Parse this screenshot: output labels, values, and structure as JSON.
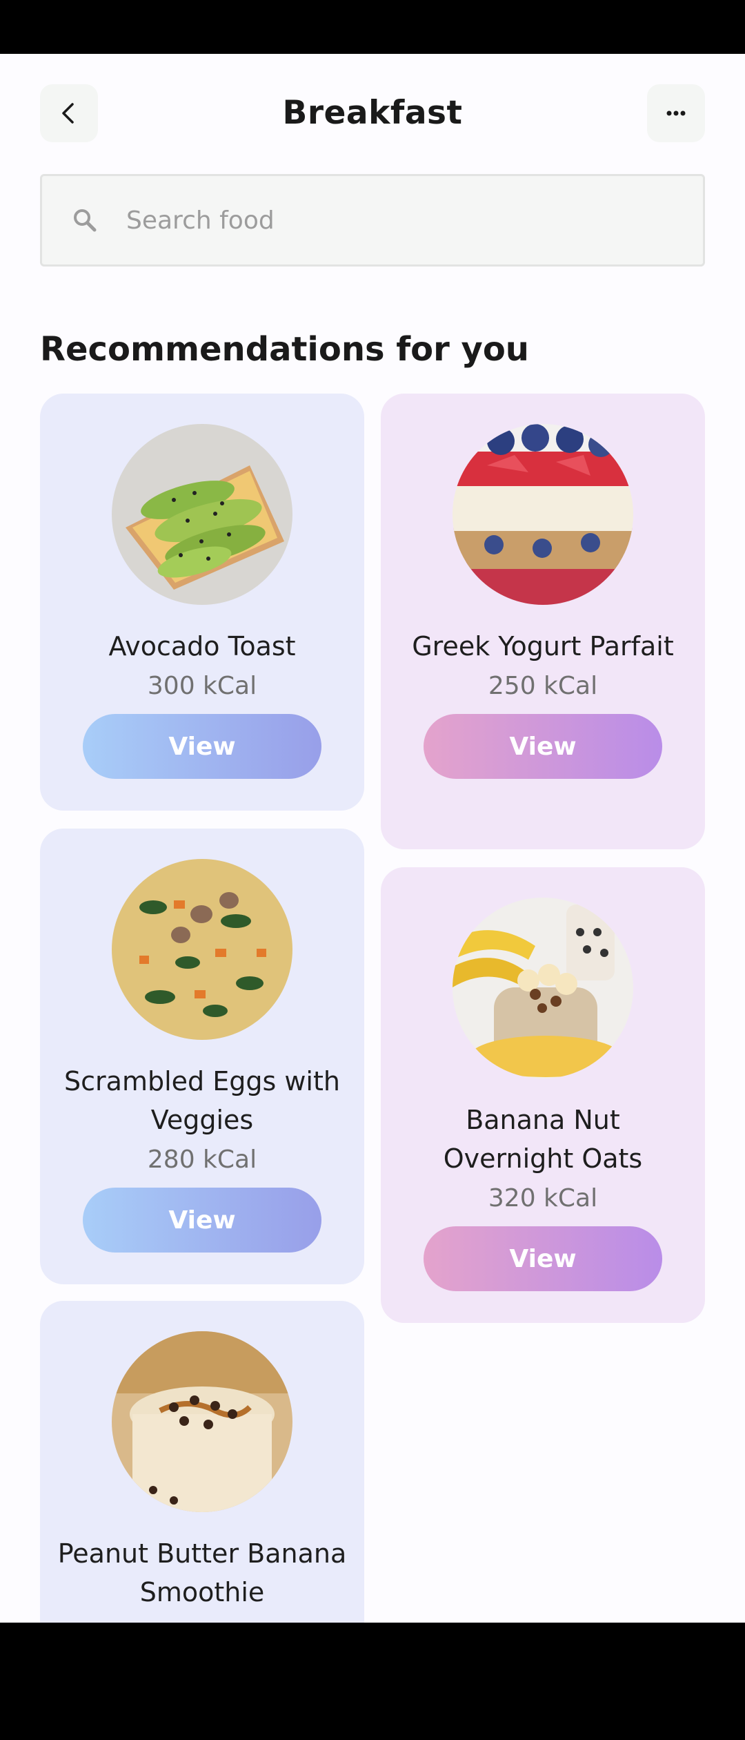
{
  "header": {
    "title": "Breakfast",
    "back_icon": "chevron-left-icon",
    "more_icon": "more-horizontal-icon"
  },
  "search": {
    "placeholder": "Search food",
    "icon": "search-icon"
  },
  "section": {
    "title": "Recommendations for you"
  },
  "colors": {
    "card_blue": "#e9ebfb",
    "card_purple": "#f2e6f8",
    "button_blue_gradient": [
      "#a8cdf8",
      "#989fe9"
    ],
    "button_purple_gradient": [
      "#e4a3cc",
      "#b98de8"
    ]
  },
  "foods": [
    {
      "name": "Avocado Toast",
      "kcal": "300 kCal",
      "button": "View"
    },
    {
      "name": "Greek Yogurt Parfait",
      "kcal": "250 kCal",
      "button": "View"
    },
    {
      "name": "Scrambled Eggs with Veggies",
      "kcal": "280 kCal",
      "button": "View"
    },
    {
      "name": "Banana Nut Overnight Oats",
      "kcal": "320 kCal",
      "button": "View"
    },
    {
      "name": "Peanut Butter Banana Smoothie",
      "kcal": "",
      "button": ""
    }
  ]
}
